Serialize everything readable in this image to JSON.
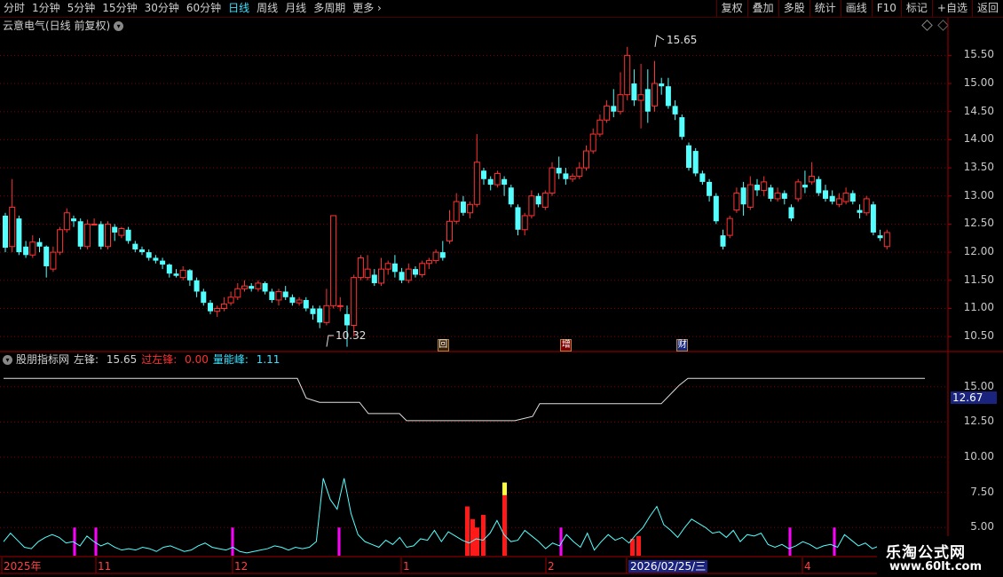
{
  "toolbar": {
    "periods": [
      {
        "label": "分时",
        "active": false
      },
      {
        "label": "1分钟",
        "active": false
      },
      {
        "label": "5分钟",
        "active": false
      },
      {
        "label": "15分钟",
        "active": false
      },
      {
        "label": "30分钟",
        "active": false
      },
      {
        "label": "60分钟",
        "active": false
      },
      {
        "label": "日线",
        "active": true
      },
      {
        "label": "周线",
        "active": false
      },
      {
        "label": "月线",
        "active": false
      },
      {
        "label": "多周期",
        "active": false
      },
      {
        "label": "更多",
        "active": false
      }
    ],
    "buttons": [
      "复权",
      "叠加",
      "多股",
      "统计",
      "画线",
      "F10",
      "标记",
      "+自选",
      "返回"
    ]
  },
  "main_chart": {
    "title": "云意电气(日线 前复权)",
    "high_label": "15.65",
    "low_label": "10.32",
    "y_ticks": [
      "15.50",
      "15.00",
      "14.50",
      "14.00",
      "13.50",
      "13.00",
      "12.50",
      "12.00",
      "11.50",
      "11.00",
      "10.50"
    ],
    "events": [
      {
        "label": "回",
        "date_index": 64
      },
      {
        "label": "增",
        "date_index": 82
      },
      {
        "label": "财",
        "date_index": 99
      }
    ]
  },
  "indicator": {
    "name": "股朋指标网",
    "left_peak_label": "左锋:",
    "left_peak_value": "15.65",
    "over_label": "过左锋:",
    "over_value": "0.00",
    "volume_peak_label": "量能峰:",
    "volume_peak_value": "1.11",
    "y_ticks": [
      "15.00",
      "12.50",
      "10.00",
      "7.50",
      "5.00"
    ],
    "current_value": "12.67"
  },
  "date_axis": {
    "labels": [
      "2025年",
      "11",
      "12",
      "1",
      "2",
      "2026/02/25/三",
      "4"
    ]
  },
  "watermark": {
    "line1": "乐淘公式网",
    "line2": "www.60lt.com"
  },
  "colors": {
    "up": "#ff3232",
    "down": "#54ffff",
    "grid": "#800000",
    "magenta": "#ff00ff",
    "white_line": "#e0e0e0"
  },
  "chart_data": {
    "type": "candlestick",
    "ylim": [
      10.25,
      15.9
    ],
    "candles": [
      [
        12.65,
        12.08,
        12.7,
        12.0
      ],
      [
        12.1,
        12.8,
        13.3,
        12.0
      ],
      [
        12.6,
        12.0,
        12.65,
        11.95
      ],
      [
        12.1,
        11.95,
        12.2,
        11.9
      ],
      [
        11.95,
        12.18,
        12.3,
        11.9
      ],
      [
        12.18,
        12.1,
        12.25,
        12.0
      ],
      [
        12.1,
        11.75,
        12.12,
        11.55
      ],
      [
        11.7,
        12.0,
        12.1,
        11.65
      ],
      [
        12.0,
        12.4,
        12.45,
        11.95
      ],
      [
        12.4,
        12.7,
        12.78,
        12.35
      ],
      [
        12.6,
        12.55,
        12.65,
        12.45
      ],
      [
        12.55,
        12.1,
        12.6,
        12.05
      ],
      [
        12.1,
        12.5,
        12.58,
        12.05
      ],
      [
        12.5,
        12.5,
        12.6,
        12.48
      ],
      [
        12.5,
        12.1,
        12.55,
        12.05
      ],
      [
        12.1,
        12.5,
        12.55,
        12.05
      ],
      [
        12.45,
        12.35,
        12.5,
        12.2
      ],
      [
        12.3,
        12.42,
        12.45,
        12.25
      ],
      [
        12.4,
        12.2,
        12.45,
        12.15
      ],
      [
        12.15,
        12.05,
        12.2,
        12.0
      ],
      [
        12.05,
        12.0,
        12.1,
        11.95
      ],
      [
        12.0,
        11.9,
        12.05,
        11.85
      ],
      [
        11.9,
        11.85,
        11.95,
        11.8
      ],
      [
        11.85,
        11.78,
        11.9,
        11.7
      ],
      [
        11.78,
        11.62,
        11.8,
        11.55
      ],
      [
        11.62,
        11.58,
        11.7,
        11.55
      ],
      [
        11.55,
        11.68,
        11.75,
        11.5
      ],
      [
        11.68,
        11.5,
        11.7,
        11.4
      ],
      [
        11.5,
        11.3,
        11.55,
        11.2
      ],
      [
        11.3,
        11.1,
        11.35,
        11.05
      ],
      [
        11.1,
        10.95,
        11.15,
        10.9
      ],
      [
        10.95,
        11.0,
        11.05,
        10.85
      ],
      [
        11.0,
        11.08,
        11.2,
        10.95
      ],
      [
        11.1,
        11.2,
        11.3,
        11.05
      ],
      [
        11.2,
        11.35,
        11.45,
        11.15
      ],
      [
        11.35,
        11.4,
        11.5,
        11.3
      ],
      [
        11.4,
        11.35,
        11.45,
        11.3
      ],
      [
        11.35,
        11.45,
        11.5,
        11.3
      ],
      [
        11.45,
        11.3,
        11.48,
        11.25
      ],
      [
        11.3,
        11.15,
        11.35,
        11.1
      ],
      [
        11.15,
        11.3,
        11.35,
        11.05
      ],
      [
        11.3,
        11.2,
        11.4,
        11.15
      ],
      [
        11.2,
        11.1,
        11.25,
        11.05
      ],
      [
        11.1,
        11.15,
        11.2,
        11.05
      ],
      [
        11.15,
        11.0,
        11.2,
        10.95
      ],
      [
        11.0,
        10.9,
        11.05,
        10.8
      ],
      [
        11.0,
        10.75,
        11.05,
        10.65
      ],
      [
        10.75,
        11.05,
        11.35,
        10.7
      ],
      [
        11.05,
        12.65,
        12.65,
        11.0
      ],
      [
        11.05,
        11.05,
        11.2,
        10.95
      ],
      [
        10.9,
        10.7,
        11.05,
        10.32
      ],
      [
        10.7,
        11.55,
        11.6,
        10.5
      ],
      [
        11.55,
        11.9,
        11.95,
        11.5
      ],
      [
        11.55,
        11.7,
        11.95,
        11.5
      ],
      [
        11.6,
        11.45,
        11.7,
        11.4
      ],
      [
        11.45,
        11.7,
        11.9,
        11.4
      ],
      [
        11.7,
        11.8,
        11.85,
        11.6
      ],
      [
        11.8,
        11.65,
        11.95,
        11.55
      ],
      [
        11.65,
        11.5,
        11.72,
        11.45
      ],
      [
        11.5,
        11.7,
        11.8,
        11.45
      ],
      [
        11.7,
        11.6,
        11.75,
        11.55
      ],
      [
        11.6,
        11.8,
        11.85,
        11.55
      ],
      [
        11.8,
        11.85,
        11.9,
        11.7
      ],
      [
        11.85,
        12.0,
        12.05,
        11.8
      ],
      [
        12.0,
        11.9,
        12.2,
        11.85
      ]
    ]
  }
}
